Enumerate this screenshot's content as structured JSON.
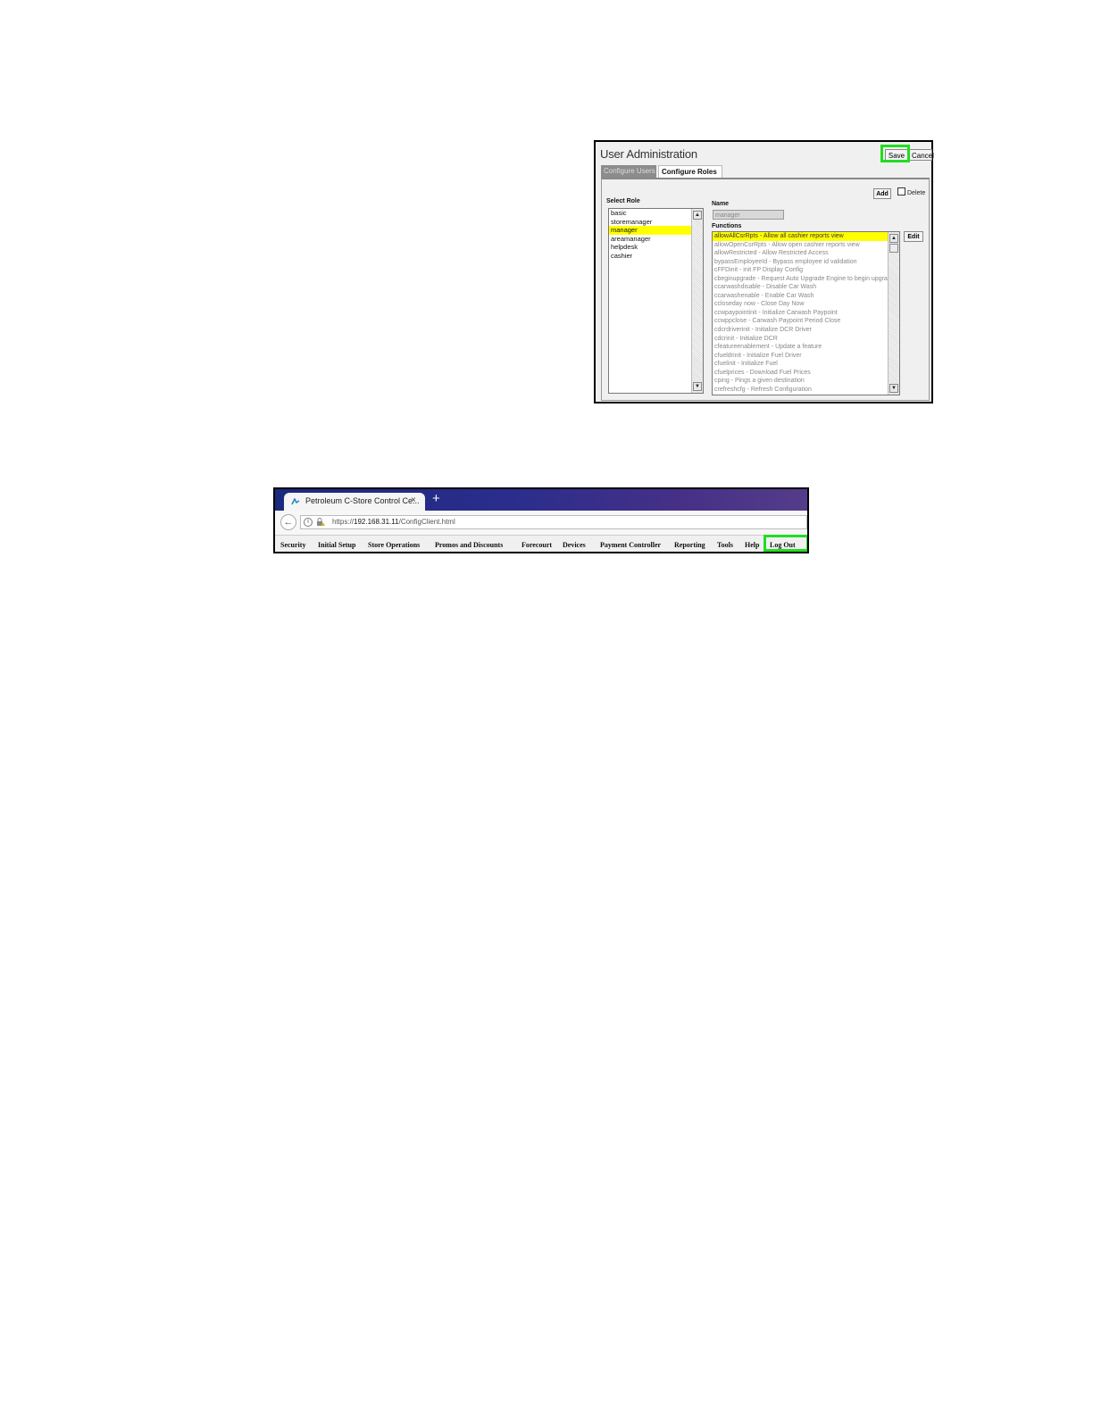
{
  "user_admin": {
    "title": "User Administration",
    "save_label": "Save",
    "cancel_label": "Cancel",
    "tabs": [
      "Configure Users",
      "Configure Roles"
    ],
    "active_tab": "Configure Roles",
    "add_label": "Add",
    "delete_label": "Delete",
    "select_role_label": "Select Role",
    "roles": [
      "basic",
      "storemanager",
      "manager",
      "areamanager",
      "helpdesk",
      "cashier"
    ],
    "selected_role": "manager",
    "name_label": "Name",
    "name_value": "manager",
    "functions_label": "Functions",
    "edit_label": "Edit",
    "functions": [
      "allowAllCsrRpts - Allow all cashier reports view",
      "allowOpenCsrRpts - Allow open cashier reports view",
      "allowRestricted - Allow Restricted Access",
      "bypassEmployeeId - Bypass employee id validation",
      "cFFDinit - init FP Display Config",
      "cbeginupgrade - Request Auto Upgrade Engine to begin upgrade",
      "ccarwashdisable - Disable Car Wash",
      "ccarwashenable - Enable Car Wash",
      "ccloseday now - Close Day Now",
      "ccwpaypointinit - Initialize Carwash Paypoint",
      "ccwppclose - Carwash Paypoint Period Close",
      "cdcrdriverinit - Initialize DCR Driver",
      "cdcrinit - Initialize DCR",
      "cfeatureenablement - Update a feature",
      "cfueldrinit - Initialize Fuel Driver",
      "cfuelinit - Initialize Fuel",
      "cfuelprices - Download Fuel Prices",
      "cping - Pings a given destination",
      "crefreshcfg - Refresh Configuration"
    ],
    "selected_function": "allowAllCsrRpts - Allow all cashier reports view"
  },
  "browser": {
    "tab_title": "Petroleum C-Store Control Ce...",
    "tab_close": "×",
    "new_tab": "+",
    "url_prefix": "https://",
    "url_host": "192.168.31.11",
    "url_path": "/ConfigClient.html",
    "menu": [
      "Security",
      "Initial Setup",
      "Store Operations",
      "Promos and Discounts",
      "Forecourt",
      "Devices",
      "Payment Controller",
      "Reporting",
      "Tools",
      "Help",
      "Log Out"
    ]
  },
  "highlight_color": "#22dd22"
}
